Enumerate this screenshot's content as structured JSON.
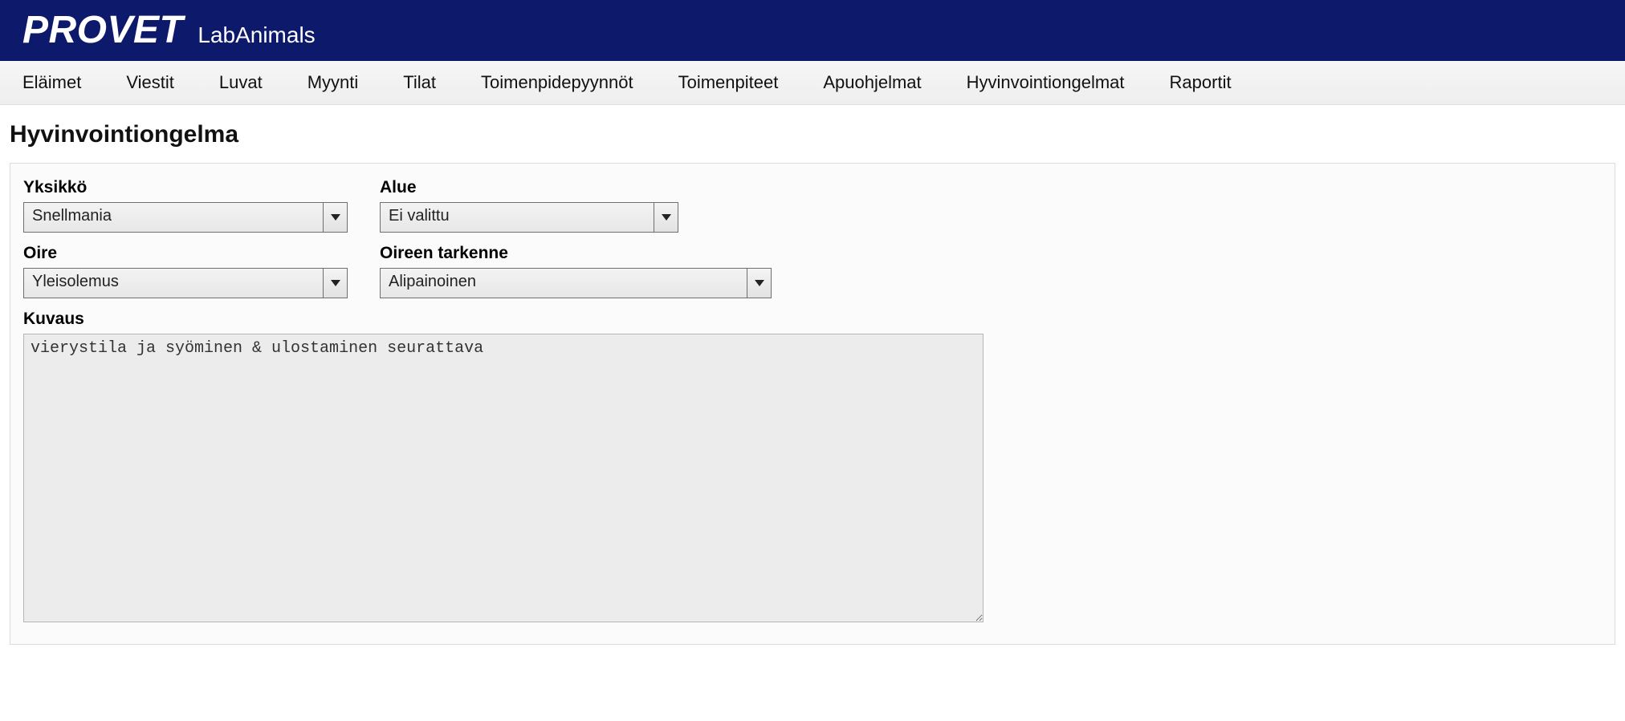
{
  "header": {
    "brand": "PROVET",
    "subtitle": "LabAnimals"
  },
  "menu": {
    "items": [
      "Eläimet",
      "Viestit",
      "Luvat",
      "Myynti",
      "Tilat",
      "Toimenpidepyynnöt",
      "Toimenpiteet",
      "Apuohjelmat",
      "Hyvinvointiongelmat",
      "Raportit"
    ]
  },
  "page": {
    "title": "Hyvinvointiongelma"
  },
  "form": {
    "yksikko": {
      "label": "Yksikkö",
      "value": "Snellmania"
    },
    "alue": {
      "label": "Alue",
      "value": "Ei valittu"
    },
    "oire": {
      "label": "Oire",
      "value": "Yleisolemus"
    },
    "tarkenne": {
      "label": "Oireen tarkenne",
      "value": "Alipainoinen"
    },
    "kuvaus": {
      "label": "Kuvaus",
      "value": "vierystila ja syöminen & ulostaminen seurattava"
    }
  }
}
